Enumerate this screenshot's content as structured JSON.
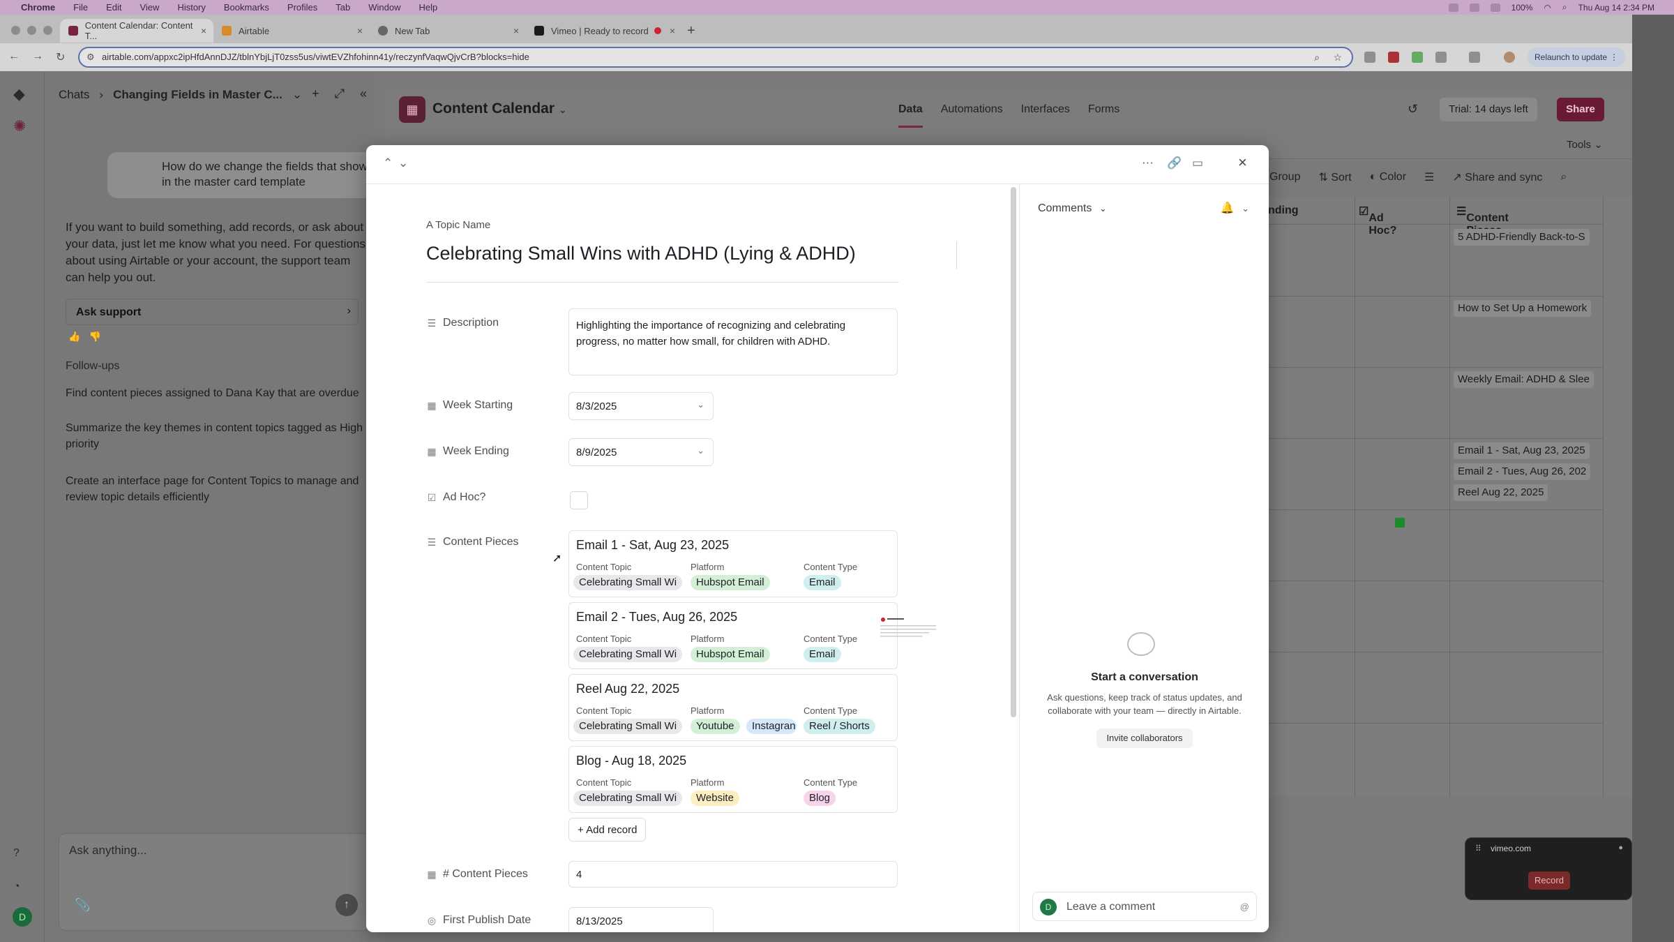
{
  "menubar": {
    "items": [
      "Chrome",
      "File",
      "Edit",
      "View",
      "History",
      "Bookmarks",
      "Profiles",
      "Tab",
      "Window",
      "Help"
    ],
    "battery": "100%",
    "clock": "Thu Aug 14  2:34 PM"
  },
  "browser": {
    "tabs": [
      {
        "label": "Content Calendar: Content T..."
      },
      {
        "label": "Airtable"
      },
      {
        "label": "New Tab"
      },
      {
        "label": "Vimeo | Ready to record"
      }
    ],
    "url": "airtable.com/appxc2ipHfdAnnDJZ/tblnYbjLjT0zss5us/viwtEVZhfohinn41y/reczynfVaqwQjvCrB?blocks=hide",
    "relaunch_label": "Relaunch to update"
  },
  "chat": {
    "breadcrumb_root": "Chats",
    "breadcrumb_current": "Changing Fields in Master C...",
    "user_message": "How do we change the fields that show in the master card template",
    "assistant_message": "If you want to build something, add records, or ask about your data, just let me know what you need. For questions about using Airtable or your account, the support team can help you out.",
    "ask_support_label": "Ask support",
    "followups_title": "Follow-ups",
    "followups": [
      "Find content pieces assigned to Dana Kay that are overdue",
      "Summarize the key themes in content topics tagged as High priority",
      "Create an interface page for Content Topics to manage and review topic details efficiently"
    ],
    "input_placeholder": "Ask anything..."
  },
  "base": {
    "title": "Content Calendar",
    "nav": [
      "Data",
      "Automations",
      "Interfaces",
      "Forms"
    ],
    "trial_label": "Trial: 14 days left",
    "share_label": "Share",
    "tools_label": "Tools"
  },
  "view_toolbar": {
    "group": "Group",
    "sort": "Sort",
    "color": "Color",
    "share_sync": "Share and sync"
  },
  "grid": {
    "col_partial": "nding",
    "col_adhoc": "Ad Hoc?",
    "col_content_pieces": "Content Pieces",
    "rows": [
      {
        "chips": [
          "5 ADHD-Friendly Back-to-S"
        ]
      },
      {
        "chips": [
          "How to Set Up a Homework"
        ]
      },
      {
        "chips": [
          "Weekly Email: ADHD & Slee"
        ]
      },
      {
        "chips": [
          "Email 1 - Sat, Aug 23, 2025",
          "Email 2 - Tues, Aug 26, 202",
          "Reel Aug 22, 2025"
        ]
      }
    ]
  },
  "record": {
    "topic_label": "Topic Name",
    "title": "Celebrating Small Wins with ADHD (Lying & ADHD)",
    "fields": {
      "description_label": "Description",
      "description": "Highlighting the importance of recognizing and celebrating progress, no matter how small, for children with ADHD.",
      "week_starting_label": "Week Starting",
      "week_starting": "8/3/2025",
      "week_ending_label": "Week Ending",
      "week_ending": "8/9/2025",
      "adhoc_label": "Ad Hoc?",
      "adhoc_checked": false,
      "content_pieces_label": "Content Pieces",
      "num_content_pieces_label": "# Content Pieces",
      "num_content_pieces": "4",
      "first_publish_label": "First Publish Date",
      "first_publish": "8/13/2025"
    },
    "sub_labels": {
      "topic": "Content Topic",
      "platform": "Platform",
      "type": "Content Type"
    },
    "content_pieces": [
      {
        "title": "Email 1 - Sat, Aug 23, 2025",
        "topic": "Celebrating Small Wi",
        "platforms": [
          "Hubspot Email"
        ],
        "type": "Email"
      },
      {
        "title": "Email 2 - Tues, Aug 26, 2025",
        "topic": "Celebrating Small Wi",
        "platforms": [
          "Hubspot Email"
        ],
        "type": "Email"
      },
      {
        "title": "Reel Aug 22, 2025",
        "topic": "Celebrating Small Wi",
        "platforms": [
          "Youtube",
          "Instagran"
        ],
        "type": "Reel / Shorts"
      },
      {
        "title": "Blog - Aug 18, 2025",
        "topic": "Celebrating Small Wi",
        "platforms": [
          "Website"
        ],
        "type": "Blog"
      }
    ],
    "add_record_label": "Add record"
  },
  "comments": {
    "header": "Comments",
    "empty_title": "Start a conversation",
    "empty_sub": "Ask questions, keep track of status updates, and collaborate with your team — directly in Airtable.",
    "invite_label": "Invite collaborators",
    "input_placeholder": "Leave a comment",
    "avatar_initial": "D"
  },
  "recorder": {
    "host": "vimeo.com",
    "record_label": "Record"
  },
  "user": {
    "initial": "D"
  }
}
